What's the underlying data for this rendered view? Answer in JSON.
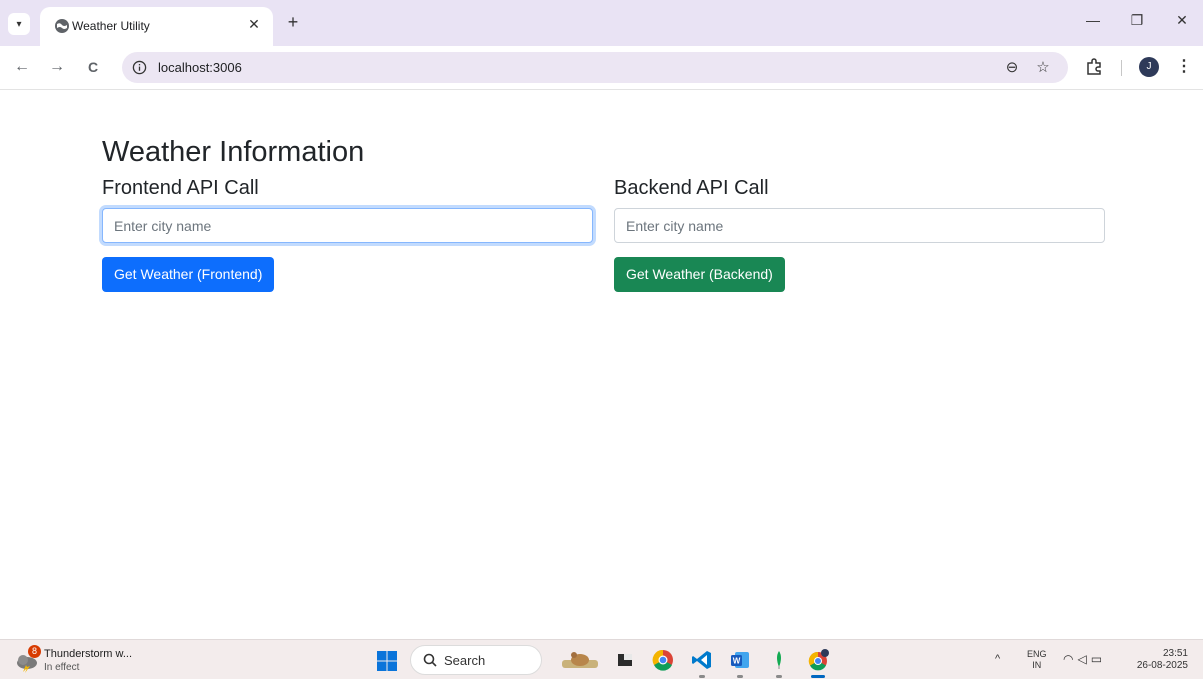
{
  "browser": {
    "tab": {
      "title": "Weather Utility",
      "close": "✕"
    },
    "new_tab": "+",
    "window_controls": {
      "minimize": "—",
      "restore": "❐",
      "close": "✕"
    },
    "nav": {
      "back": "←",
      "forward": "→",
      "reload": "C"
    },
    "url": "localhost:3006",
    "zoom_icon": "⊖",
    "star_icon": "☆",
    "avatar_initial": "J",
    "menu": "⋮"
  },
  "page": {
    "title": "Weather Information",
    "frontend": {
      "heading": "Frontend API Call",
      "placeholder": "Enter city name",
      "value": "",
      "button": "Get Weather (Frontend)"
    },
    "backend": {
      "heading": "Backend API Call",
      "placeholder": "Enter city name",
      "value": "",
      "button": "Get Weather (Backend)"
    }
  },
  "taskbar": {
    "weather": {
      "badge": "8",
      "title": "Thunderstorm w...",
      "subtitle": "In effect"
    },
    "search_label": "Search",
    "tray": {
      "caret": "^",
      "lang_top": "ENG",
      "lang_bottom": "IN",
      "time": "23:51",
      "date": "26-08-2025"
    }
  },
  "colors": {
    "primary": "#0d6efd",
    "success": "#198754",
    "tabstrip": "#e9e3f4",
    "omnibox": "#ece6f3"
  }
}
